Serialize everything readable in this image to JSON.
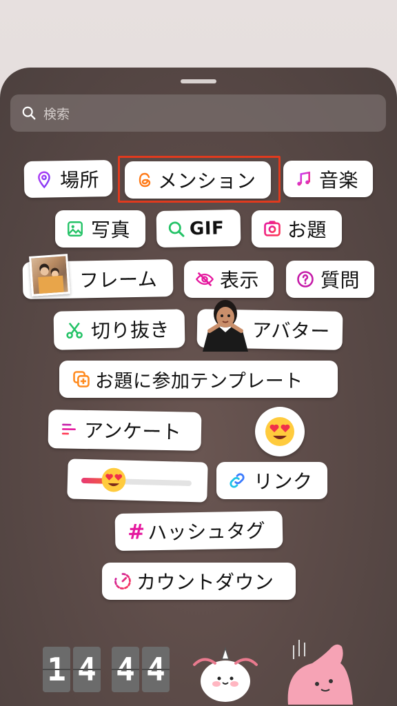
{
  "search": {
    "placeholder": "検索"
  },
  "stickers": {
    "location": "場所",
    "mention": "メンション",
    "music": "音楽",
    "photo": "写真",
    "gif": "GIF",
    "question_prompt": "お題",
    "frame": "フレーム",
    "show": "表示",
    "question": "質問",
    "cutout": "切り抜き",
    "avatar": "アバター",
    "add_yours_template": "お題に参加テンプレート",
    "poll": "アンケート",
    "link": "リンク",
    "hashtag": "ハッシュタグ",
    "countdown": "カウントダウン"
  },
  "emoji_slider": {
    "value_fraction": 0.25
  },
  "clock": {
    "digits": [
      "1",
      "4",
      "4",
      "4"
    ]
  },
  "colors": {
    "highlight": "#e03a1e",
    "purple": "#9b3cf5",
    "orange": "#ff8a1e",
    "magenta": "#e5189e",
    "green": "#23c266",
    "blue": "#3a7bfd"
  },
  "icons": [
    "search-icon",
    "pin-icon",
    "threads-icon",
    "music-note-icon",
    "image-icon",
    "search-icon",
    "camera-icon",
    "eye-slash-icon",
    "question-icon",
    "scissors-icon",
    "plus-square-icon",
    "poll-icon",
    "link-icon",
    "hash-icon",
    "countdown-icon"
  ]
}
